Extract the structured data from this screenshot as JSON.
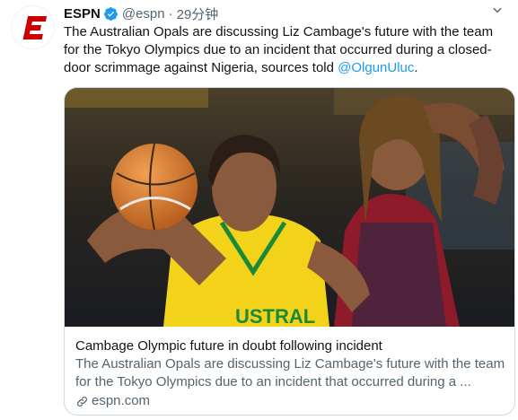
{
  "tweet": {
    "author_name": "ESPN",
    "handle": "@espn",
    "separator": "·",
    "time": "29分钟",
    "text_before": "The Australian Opals are discussing Liz Cambage's future with the team for the Tokyo Olympics due to an incident that occurred during a closed-door scrimmage against Nigeria, sources told ",
    "mention": "@OlgunUluc",
    "text_after": "."
  },
  "card": {
    "title": "Cambage Olympic future in doubt following incident",
    "description": "The Australian Opals are discussing Liz Cambage's future with the team for the Tokyo Olympics due to an incident that occurred during a ...",
    "domain": "espn.com",
    "jersey_text": "USTRAL"
  },
  "icons": {
    "avatar": "espn-logo",
    "verified": "verified-badge-icon",
    "more": "chevron-down-icon",
    "link": "link-icon"
  },
  "colors": {
    "accent": "#1d9bf0",
    "brand": "#cc0000",
    "text_primary": "#0f1419",
    "text_secondary": "#536471",
    "border": "#cfd9de"
  }
}
